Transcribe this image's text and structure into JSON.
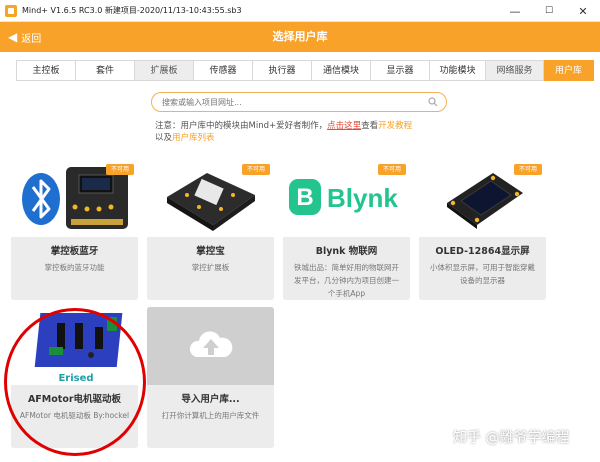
{
  "window": {
    "title": "Mind+ V1.6.5 RC3.0   新建项目-2020/11/13-10:43:55.sb3",
    "minimize": "—",
    "maximize": "☐",
    "close": "✕"
  },
  "header": {
    "back_label": "返回",
    "title": "选择用户库"
  },
  "tabs": [
    {
      "label": "主控板"
    },
    {
      "label": "套件"
    },
    {
      "label": "扩展板"
    },
    {
      "label": "传感器"
    },
    {
      "label": "执行器"
    },
    {
      "label": "通信模块"
    },
    {
      "label": "显示器"
    },
    {
      "label": "功能模块"
    },
    {
      "label": "网络服务"
    },
    {
      "label": "用户库"
    }
  ],
  "search": {
    "placeholder": "搜索或输入项目网址..."
  },
  "notice": {
    "text1": "注意：用户库中的模块由Mind+爱好者制作，",
    "link1": "点击这里",
    "text2": "查看",
    "link2": "开发教程",
    "text3": "以及",
    "link3": "用户库列表"
  },
  "cards": [
    {
      "name": "掌控板蓝牙",
      "desc": "掌控板的蓝牙功能",
      "badge": "不可用"
    },
    {
      "name": "掌控宝",
      "desc": "掌控扩展板",
      "badge": "不可用"
    },
    {
      "name": "Blynk 物联网",
      "desc": "铁城出品：简单好用的物联网开发平台，几分钟内为项目创建一个手机App",
      "badge": "不可用",
      "logo_text": "Blynk",
      "logo_letter": "B"
    },
    {
      "name": "OLED-12864显示屏",
      "desc": "小体积显示屏，可用于智能穿戴设备的显示器",
      "badge": "不可用"
    },
    {
      "name": "AFMotor电机驱动板",
      "desc": "AFMotor 电机驱动板 By:hockel",
      "brand": "Erised"
    },
    {
      "name": "导入用户库...",
      "desc": "打开你计算机上的用户库文件"
    }
  ],
  "watermark": "知乎 @雕爷学编程",
  "colors": {
    "accent": "#f8a229",
    "link": "#e24c3c",
    "annotation": "#e00000"
  }
}
